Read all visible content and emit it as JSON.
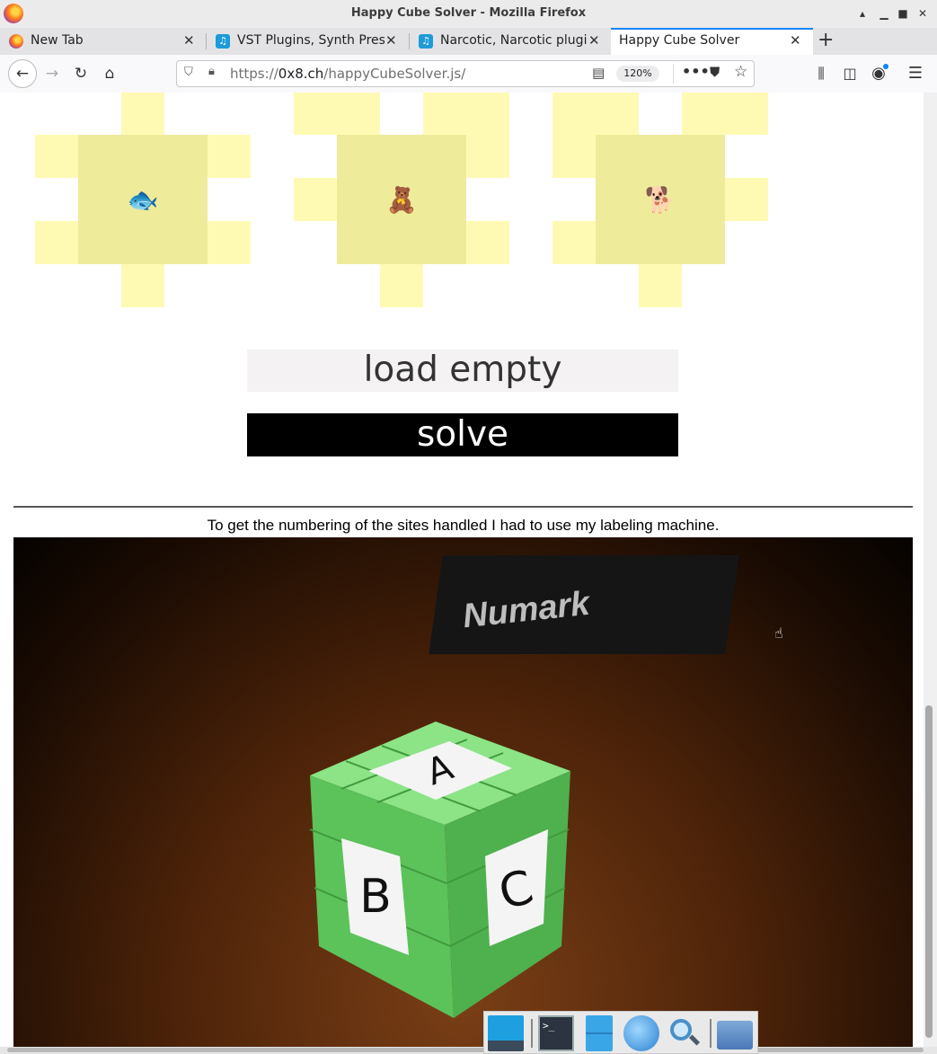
{
  "window": {
    "title": "Happy Cube Solver - Mozilla Firefox"
  },
  "tabs": [
    {
      "label": "New Tab",
      "selected": false
    },
    {
      "label": "VST Plugins, Synth Prese",
      "selected": false
    },
    {
      "label": "Narcotic, Narcotic plugin",
      "selected": false
    },
    {
      "label": "Happy Cube Solver",
      "selected": true
    }
  ],
  "navbar": {
    "url_prefix": "https://",
    "url_domain": "0x8.ch",
    "url_path": "/happyCubeSolver.js/",
    "zoom": "120%"
  },
  "pieces": [
    {
      "emoji": "🐟",
      "name": "fish"
    },
    {
      "emoji": "🧸",
      "name": "teddy-bear"
    },
    {
      "emoji": "🐕",
      "name": "dog"
    }
  ],
  "buttons": {
    "load_empty": "load empty",
    "solve": "solve"
  },
  "caption": "To get the numbering of the sites handled I had to use my labeling machine.",
  "photo": {
    "brand_text": "Numark",
    "cube_labels": [
      "A",
      "B",
      "C"
    ]
  },
  "colors": {
    "piece_edge": "#fffab3",
    "piece_center": "#eeeb9b",
    "cube_green": "#6fd46a",
    "accent": "#0a84ff"
  }
}
